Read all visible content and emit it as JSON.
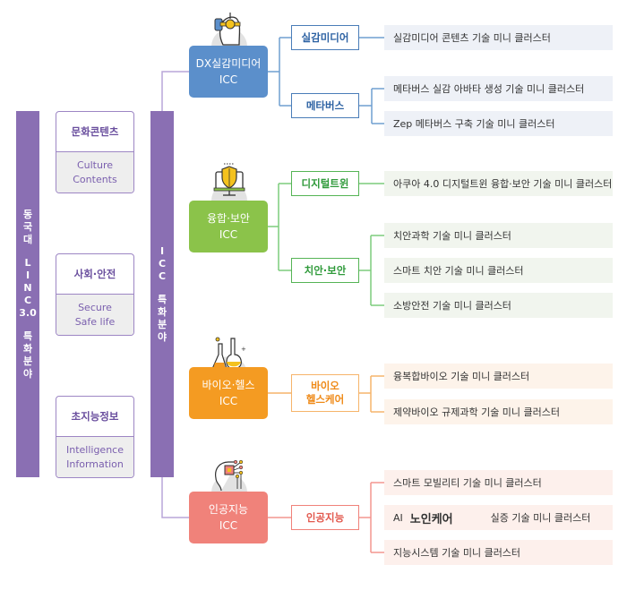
{
  "left_bar": {
    "line1": [
      "동",
      "국",
      "대"
    ],
    "line2": [
      "L",
      "I",
      "N",
      "C",
      "3.0"
    ],
    "line3": [
      "특",
      "화",
      "분",
      "야"
    ]
  },
  "categories": [
    {
      "ko": "문화콘텐츠",
      "en": [
        "Culture",
        "Contents"
      ]
    },
    {
      "ko": "사회·안전",
      "en": [
        "Secure",
        "Safe life"
      ]
    },
    {
      "ko": "초지능정보",
      "en": [
        "Intelligence",
        "Information"
      ]
    }
  ],
  "icc_bar": {
    "line1": [
      "I",
      "C",
      "C"
    ],
    "line2": [
      "특",
      "화",
      "분",
      "야"
    ]
  },
  "colors": {
    "purple": "#8a6fb3",
    "blue": "#5b8fcb",
    "green": "#8bc34a",
    "orange": "#f49b22",
    "red": "#f0827a"
  },
  "iccs": [
    {
      "name": "DX실감미디어",
      "suffix": "ICC",
      "icon": "vr-headset-icon",
      "subs": [
        {
          "label": "실감미디어",
          "leaves": [
            {
              "text": "실감미디어 콘텐츠 기술 미니 클러스터"
            }
          ]
        },
        {
          "label": "메타버스",
          "leaves": [
            {
              "text": "메타버스 실감 아바타 생성 기술 미니 클러스터"
            },
            {
              "text": "Zep 메타버스 구축 기술 미니 클러스터"
            }
          ]
        }
      ]
    },
    {
      "name": "융합·보안",
      "suffix": "ICC",
      "icon": "security-shield-monitor-icon",
      "subs": [
        {
          "label": "디지털트윈",
          "leaves": [
            {
              "text": "아쿠아 4.0 디지털트윈 융합·보안 기술 미니 클러스터"
            }
          ]
        },
        {
          "label": "치안·보안",
          "leaves": [
            {
              "text": "치안과학 기술 미니 클러스터"
            },
            {
              "text": "스마트 치안 기술 미니 클러스터"
            },
            {
              "text": "소방안전 기술 미니 클러스터"
            }
          ]
        }
      ]
    },
    {
      "name": "바이오·헬스",
      "suffix": "ICC",
      "icon": "lab-flask-icon",
      "subs": [
        {
          "label": "바이오",
          "label2": "헬스케어",
          "leaves": [
            {
              "text": "융복합바이오 기술 미니 클러스터"
            },
            {
              "text": "제약바이오 규제과학 기술 미니 클러스터"
            }
          ]
        }
      ]
    },
    {
      "name": "인공지능",
      "suffix": "ICC",
      "icon": "ai-brain-chip-icon",
      "subs": [
        {
          "label": "인공지능",
          "leaves": [
            {
              "text": "스마트 모빌리티 기술 미니 클러스터"
            },
            {
              "prefix": "AI",
              "big": "노인케어",
              "text": "실증 기술 미니 클러스터"
            },
            {
              "text": "지능시스템 기술 미니 클러스터"
            }
          ]
        }
      ]
    }
  ]
}
